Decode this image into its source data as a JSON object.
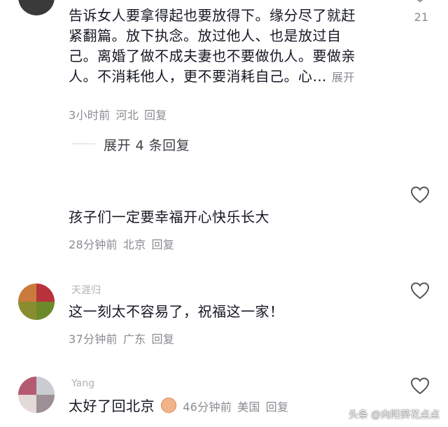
{
  "comments": [
    {
      "lines": [
        "告诉女人要拿得起也要放得下。缘分尽了就赶",
        "紧翻篇。放下执念。放过他人、也是放过自",
        "己。离婚了做不成夫妻也不要做仇人。要做亲",
        "人。不消耗他人，更不要消耗自己。心…"
      ],
      "expand_label": "展开",
      "time": "3小时前",
      "location": "河北",
      "reply_label": "回复",
      "like_count": "21",
      "replies_toggle": "展开 4 条回复"
    },
    {
      "text": "孩子们一定要幸福开心快乐长大",
      "time": "28分钟前",
      "location": "北京",
      "reply_label": "回复"
    },
    {
      "username": "天涯归",
      "text": "这一刻太不容易了，祝福这一家！",
      "time": "37分钟前",
      "location": "广东",
      "reply_label": "回复"
    },
    {
      "username": "Yang",
      "text": "太好了回北京",
      "time": "46分钟前",
      "location": "美国",
      "reply_label": "回复"
    }
  ],
  "watermark": "头条 @向阳葵花点点",
  "colors": {
    "meta": "#8a8b91",
    "text": "#161823"
  }
}
